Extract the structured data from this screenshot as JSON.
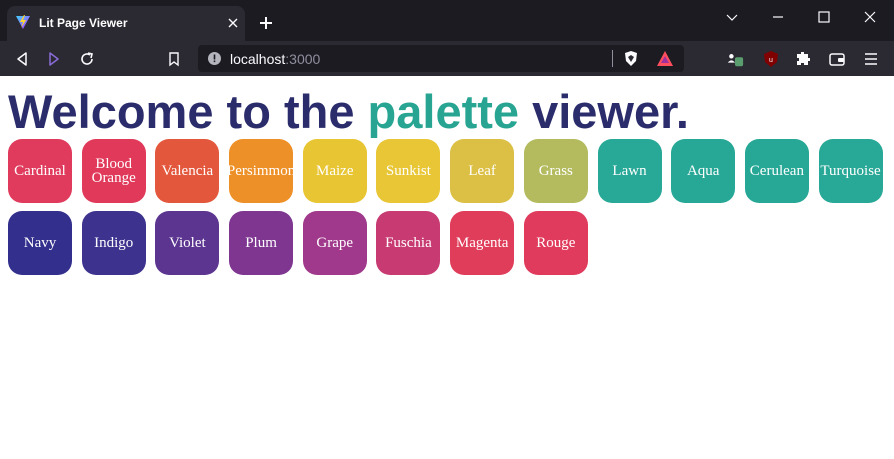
{
  "browser": {
    "tab_title": "Lit Page Viewer",
    "url_host": "localhost",
    "url_port": ":3000",
    "theme": {
      "chrome_dark": "#1c1b22",
      "toolbar": "#2b2a33",
      "text": "#fbfbfe"
    }
  },
  "page": {
    "headline_before": "Welcome to the ",
    "headline_accent": "palette",
    "headline_after": " viewer.",
    "headline_color": "#2b2c6b",
    "accent_color": "#27a592"
  },
  "swatches": [
    {
      "name": "Cardinal",
      "color": "#e03b5d"
    },
    {
      "name": "Blood Orange",
      "color": "#e0395a"
    },
    {
      "name": "Valencia",
      "color": "#e3573c"
    },
    {
      "name": "Persimmon",
      "color": "#ee9028"
    },
    {
      "name": "Maize",
      "color": "#e8c532"
    },
    {
      "name": "Sunkist",
      "color": "#e8c636"
    },
    {
      "name": "Leaf",
      "color": "#dcbf45"
    },
    {
      "name": "Grass",
      "color": "#b3bb5e"
    },
    {
      "name": "Lawn",
      "color": "#28a896"
    },
    {
      "name": "Aqua",
      "color": "#27a896"
    },
    {
      "name": "Cerulean",
      "color": "#27a896"
    },
    {
      "name": "Turquoise",
      "color": "#28a896"
    },
    {
      "name": "Navy",
      "color": "#332f8c"
    },
    {
      "name": "Indigo",
      "color": "#3d338f"
    },
    {
      "name": "Violet",
      "color": "#5c3591"
    },
    {
      "name": "Plum",
      "color": "#7e3691"
    },
    {
      "name": "Grape",
      "color": "#a0388b"
    },
    {
      "name": "Fuschia",
      "color": "#c83b72"
    },
    {
      "name": "Magenta",
      "color": "#e03d5b"
    },
    {
      "name": "Rouge",
      "color": "#e03b5c"
    }
  ]
}
